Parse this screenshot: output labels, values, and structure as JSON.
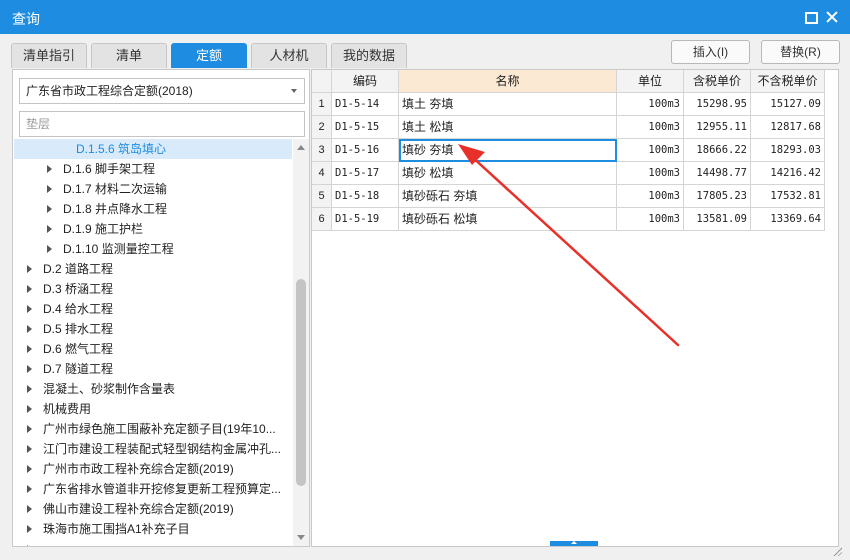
{
  "window": {
    "title": "查询"
  },
  "tabs": [
    {
      "label": "清单指引",
      "active": false
    },
    {
      "label": "清单",
      "active": false
    },
    {
      "label": "定额",
      "active": true
    },
    {
      "label": "人材机",
      "active": false
    },
    {
      "label": "我的数据",
      "active": false
    }
  ],
  "actions": {
    "insert_label": "插入(I)",
    "replace_label": "替换(R)"
  },
  "left": {
    "library_select": "广东省市政工程综合定额(2018)",
    "search_placeholder": "垫层",
    "tree": [
      {
        "label": "D.1.5.6 筑岛填心",
        "selected": true,
        "has_children": false
      },
      {
        "label": "D.1.6 脚手架工程",
        "has_children": true
      },
      {
        "label": "D.1.7 材料二次运输",
        "has_children": true
      },
      {
        "label": "D.1.8 井点降水工程",
        "has_children": true
      },
      {
        "label": "D.1.9 施工护栏",
        "has_children": true
      },
      {
        "label": "D.1.10 监测量控工程",
        "has_children": true
      },
      {
        "label": "D.2 道路工程",
        "has_children": true
      },
      {
        "label": "D.3 桥涵工程",
        "has_children": true
      },
      {
        "label": "D.4 给水工程",
        "has_children": true
      },
      {
        "label": "D.5 排水工程",
        "has_children": true
      },
      {
        "label": "D.6 燃气工程",
        "has_children": true
      },
      {
        "label": "D.7 隧道工程",
        "has_children": true
      },
      {
        "label": "混凝土、砂浆制作含量表",
        "has_children": true
      },
      {
        "label": "机械费用",
        "has_children": true
      },
      {
        "label": "广州市绿色施工围蔽补充定额子目(19年10...",
        "has_children": true
      },
      {
        "label": "江门市建设工程装配式轻型钢结构金属冲孔...",
        "has_children": true
      },
      {
        "label": "广州市市政工程补充综合定额(2019)",
        "has_children": true
      },
      {
        "label": "广东省排水管道非开挖修复更新工程预算定...",
        "has_children": true
      },
      {
        "label": "佛山市建设工程补充综合定额(2019)",
        "has_children": true
      },
      {
        "label": "珠海市施工围挡A1补充子目",
        "has_children": true
      },
      {
        "label": "",
        "has_children": true
      }
    ]
  },
  "grid": {
    "headers": {
      "code": "编码",
      "name": "名称",
      "unit": "单位",
      "price_tax": "含税单价",
      "price_notax": "不含税单价"
    },
    "rows": [
      {
        "no": "1",
        "code": "D1-5-14",
        "name": "填土 夯填",
        "unit": "100m3",
        "price_tax": "15298.95",
        "price_notax": "15127.09"
      },
      {
        "no": "2",
        "code": "D1-5-15",
        "name": "填土 松填",
        "unit": "100m3",
        "price_tax": "12955.11",
        "price_notax": "12817.68"
      },
      {
        "no": "3",
        "code": "D1-5-16",
        "name": "填砂 夯填",
        "unit": "100m3",
        "price_tax": "18666.22",
        "price_notax": "18293.03"
      },
      {
        "no": "4",
        "code": "D1-5-17",
        "name": "填砂 松填",
        "unit": "100m3",
        "price_tax": "14498.77",
        "price_notax": "14216.42"
      },
      {
        "no": "5",
        "code": "D1-5-18",
        "name": "填砂砾石 夯填",
        "unit": "100m3",
        "price_tax": "17805.23",
        "price_notax": "17532.81"
      },
      {
        "no": "6",
        "code": "D1-5-19",
        "name": "填砂砾石 松填",
        "unit": "100m3",
        "price_tax": "13581.09",
        "price_notax": "13369.64"
      }
    ],
    "selected_row": 3
  },
  "colors": {
    "accent": "#1e8ce0",
    "annotation": "#e8302a",
    "name_header": "#fbe9d4"
  }
}
